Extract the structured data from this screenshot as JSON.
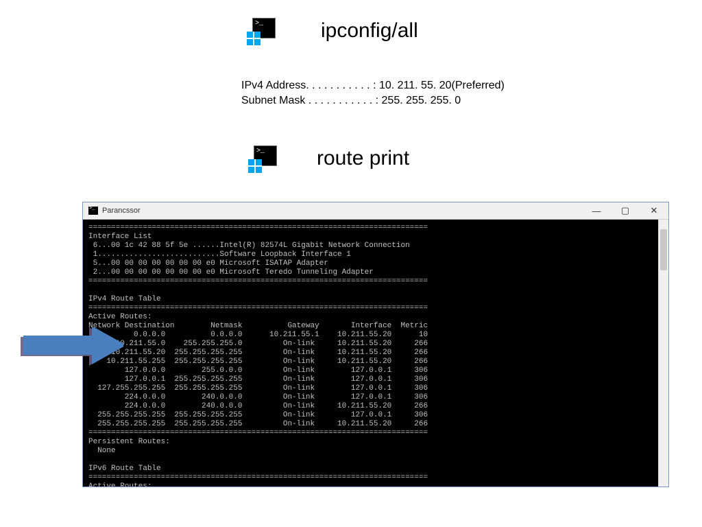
{
  "headings": {
    "ipconfig": "ipconfig/all",
    "route": "route print"
  },
  "ipconfig_output": {
    "line1": "IPv4 Address. . . . . . . . . . . : 10. 211. 55. 20(Preferred)",
    "line2": "Subnet Mask . . . . . . . . . . . : 255. 255. 255. 0"
  },
  "cmd_window": {
    "title": "Parancssor",
    "min": "—",
    "max": "▢",
    "close": "✕"
  },
  "route_lines": [
    "===========================================================================",
    "Interface List",
    " 6...00 1c 42 88 5f 5e ......Intel(R) 82574L Gigabit Network Connection",
    " 1...........................Software Loopback Interface 1",
    " 5...00 00 00 00 00 00 00 e0 Microsoft ISATAP Adapter",
    " 2...00 00 00 00 00 00 00 e0 Microsoft Teredo Tunneling Adapter",
    "===========================================================================",
    "",
    "IPv4 Route Table",
    "===========================================================================",
    "Active Routes:",
    "Network Destination        Netmask          Gateway       Interface  Metric",
    "          0.0.0.0          0.0.0.0      10.211.55.1    10.211.55.20      10",
    "      10.211.55.0    255.255.255.0         On-link     10.211.55.20     266",
    "     10.211.55.20  255.255.255.255         On-link     10.211.55.20     266",
    "    10.211.55.255  255.255.255.255         On-link     10.211.55.20     266",
    "        127.0.0.0        255.0.0.0         On-link        127.0.0.1     306",
    "        127.0.0.1  255.255.255.255         On-link        127.0.0.1     306",
    "  127.255.255.255  255.255.255.255         On-link        127.0.0.1     306",
    "        224.0.0.0        240.0.0.0         On-link        127.0.0.1     306",
    "        224.0.0.0        240.0.0.0         On-link     10.211.55.20     266",
    "  255.255.255.255  255.255.255.255         On-link        127.0.0.1     306",
    "  255.255.255.255  255.255.255.255         On-link     10.211.55.20     266",
    "===========================================================================",
    "Persistent Routes:",
    "  None",
    "",
    "IPv6 Route Table",
    "===========================================================================",
    "Active Routes:"
  ],
  "arrow_color_back": "#6b5a82",
  "arrow_color_front": "#4a7fbf"
}
